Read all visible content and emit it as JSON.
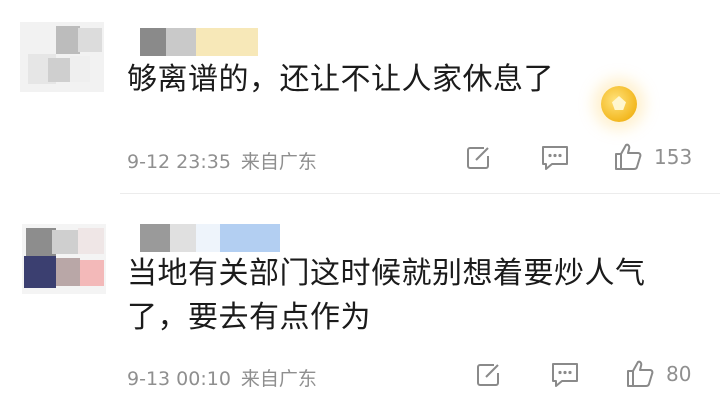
{
  "comments": [
    {
      "text": "够离谱的，还让不让人家休息了",
      "time": "9-12 23:35",
      "location": "来自广东",
      "likes": "153",
      "icons": [
        "forward-icon",
        "comment-icon",
        "like-icon",
        "gold-coin-badge"
      ]
    },
    {
      "text_line1": "当地有关部门这时候就别想着要炒人气",
      "text_line2": "了，要去有点作为",
      "time": "9-13 00:10",
      "location": "来自广东",
      "likes": "80",
      "icons": [
        "forward-icon",
        "comment-icon",
        "like-icon"
      ]
    }
  ]
}
